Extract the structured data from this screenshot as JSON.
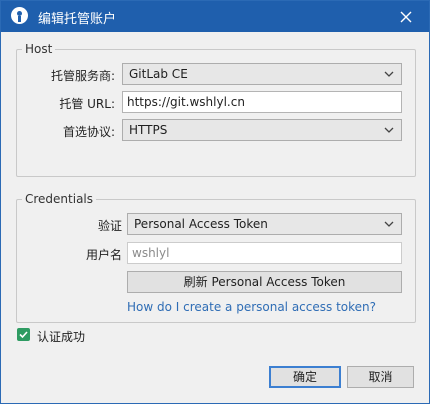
{
  "window": {
    "title": "编辑托管账户"
  },
  "host": {
    "legend": "Host",
    "provider_label": "托管服务商:",
    "provider_value": "GitLab CE",
    "url_label": "托管 URL:",
    "url_value": "https://git.wshlyl.cn",
    "protocol_label": "首选协议:",
    "protocol_value": "HTTPS"
  },
  "credentials": {
    "legend": "Credentials",
    "auth_label": "验证",
    "auth_value": "Personal Access Token",
    "username_label": "用户名",
    "username_value": "wshlyl",
    "refresh_button": "刷新 Personal Access Token",
    "help_link": "How do I create a personal access token?"
  },
  "status": {
    "checked": true,
    "label": "认证成功"
  },
  "buttons": {
    "ok": "确定",
    "cancel": "取消"
  },
  "icons": {
    "app": "sourcetree-logo-icon",
    "close": "close-icon",
    "dropdown": "chevron-down-icon",
    "check": "check-icon"
  },
  "colors": {
    "titlebar": "#1f5fad",
    "link": "#2f6db5",
    "checkbox": "#2e9b62",
    "primary_border": "#3c7fd1"
  }
}
